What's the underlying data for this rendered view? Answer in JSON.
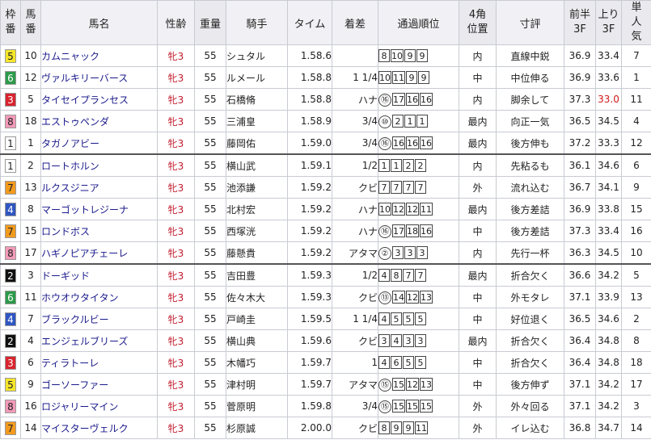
{
  "headers": {
    "waku": "枠番",
    "umaban": "馬番",
    "horse": "馬名",
    "age": "性齢",
    "weight": "重量",
    "jockey": "騎手",
    "time": "タイム",
    "margin": "着差",
    "passing": "通過順位",
    "pos4": "4角位置",
    "comment": "寸評",
    "first3f": "前半3F",
    "last3f": "上り3F",
    "pop": "単人気"
  },
  "waku_colors": {
    "1": {
      "bg": "#ffffff",
      "fg": "#222222"
    },
    "2": {
      "bg": "#111111",
      "fg": "#ffffff"
    },
    "3": {
      "bg": "#d8242e",
      "fg": "#ffffff"
    },
    "4": {
      "bg": "#2f56c2",
      "fg": "#ffffff"
    },
    "5": {
      "bg": "#f5e52a",
      "fg": "#222222"
    },
    "6": {
      "bg": "#2c9a4a",
      "fg": "#ffffff"
    },
    "7": {
      "bg": "#f29a1e",
      "fg": "#222222"
    },
    "8": {
      "bg": "#f39ab8",
      "fg": "#222222"
    }
  },
  "rows": [
    {
      "waku": "5",
      "umaban": "10",
      "horse": "カムニャック",
      "age": "牝3",
      "weight": "55",
      "jockey": "シュタル",
      "time": "1.58.6",
      "margin": "",
      "passing": [
        {
          "v": "8"
        },
        {
          "v": "10"
        },
        {
          "v": "9"
        },
        {
          "v": "9"
        }
      ],
      "pos4": "内",
      "comment": "直線中鋭",
      "first3f": "36.9",
      "last3f": "33.4",
      "last3f_best": false,
      "pop": "7"
    },
    {
      "waku": "6",
      "umaban": "12",
      "horse": "ヴァルキリーバース",
      "age": "牝3",
      "weight": "55",
      "jockey": "ルメール",
      "time": "1.58.8",
      "margin": "1 1/4",
      "passing": [
        {
          "v": "10"
        },
        {
          "v": "11"
        },
        {
          "v": "9"
        },
        {
          "v": "9"
        }
      ],
      "pos4": "中",
      "comment": "中位伸る",
      "first3f": "36.9",
      "last3f": "33.6",
      "last3f_best": false,
      "pop": "1"
    },
    {
      "waku": "3",
      "umaban": "5",
      "horse": "タイセイプランセス",
      "age": "牝3",
      "weight": "55",
      "jockey": "石橋脩",
      "time": "1.58.8",
      "margin": "ハナ",
      "passing": [
        {
          "v": "⑯",
          "c": true
        },
        {
          "v": "17"
        },
        {
          "v": "16"
        },
        {
          "v": "16"
        }
      ],
      "pos4": "内",
      "comment": "脚余して",
      "first3f": "37.3",
      "last3f": "33.0",
      "last3f_best": true,
      "pop": "11"
    },
    {
      "waku": "8",
      "umaban": "18",
      "horse": "エストゥペンダ",
      "age": "牝3",
      "weight": "55",
      "jockey": "三浦皇",
      "time": "1.58.9",
      "margin": "3/4",
      "passing": [
        {
          "v": "⑩",
          "c": true
        },
        {
          "v": "2"
        },
        {
          "v": "1"
        },
        {
          "v": "1"
        }
      ],
      "pos4": "最内",
      "comment": "向正一気",
      "first3f": "36.5",
      "last3f": "34.5",
      "last3f_best": false,
      "pop": "4"
    },
    {
      "waku": "1",
      "umaban": "1",
      "horse": "タガノアビー",
      "age": "牝3",
      "weight": "55",
      "jockey": "藤岡佑",
      "time": "1.59.0",
      "margin": "3/4",
      "passing": [
        {
          "v": "⑯",
          "c": true
        },
        {
          "v": "16"
        },
        {
          "v": "16"
        },
        {
          "v": "16"
        }
      ],
      "pos4": "最内",
      "comment": "後方伸も",
      "first3f": "37.2",
      "last3f": "33.3",
      "last3f_best": false,
      "pop": "12"
    },
    {
      "waku": "1",
      "umaban": "2",
      "horse": "ロートホルン",
      "age": "牝3",
      "weight": "55",
      "jockey": "横山武",
      "time": "1.59.1",
      "margin": "1/2",
      "passing": [
        {
          "v": "1"
        },
        {
          "v": "1"
        },
        {
          "v": "2"
        },
        {
          "v": "2"
        }
      ],
      "pos4": "内",
      "comment": "先粘るも",
      "first3f": "36.1",
      "last3f": "34.6",
      "last3f_best": false,
      "pop": "6"
    },
    {
      "waku": "7",
      "umaban": "13",
      "horse": "ルクスジニア",
      "age": "牝3",
      "weight": "55",
      "jockey": "池添謙",
      "time": "1.59.2",
      "margin": "クビ",
      "passing": [
        {
          "v": "7"
        },
        {
          "v": "7"
        },
        {
          "v": "7"
        },
        {
          "v": "7"
        }
      ],
      "pos4": "外",
      "comment": "流れ込む",
      "first3f": "36.7",
      "last3f": "34.1",
      "last3f_best": false,
      "pop": "9"
    },
    {
      "waku": "4",
      "umaban": "8",
      "horse": "マーゴットレジーナ",
      "age": "牝3",
      "weight": "55",
      "jockey": "北村宏",
      "time": "1.59.2",
      "margin": "ハナ",
      "passing": [
        {
          "v": "10"
        },
        {
          "v": "12"
        },
        {
          "v": "12"
        },
        {
          "v": "11"
        }
      ],
      "pos4": "最内",
      "comment": "後方差詰",
      "first3f": "36.9",
      "last3f": "33.8",
      "last3f_best": false,
      "pop": "15"
    },
    {
      "waku": "7",
      "umaban": "15",
      "horse": "ロンドボス",
      "age": "牝3",
      "weight": "55",
      "jockey": "西塚洸",
      "time": "1.59.2",
      "margin": "ハナ",
      "passing": [
        {
          "v": "⑯",
          "c": true
        },
        {
          "v": "17"
        },
        {
          "v": "18"
        },
        {
          "v": "16"
        }
      ],
      "pos4": "中",
      "comment": "後方差詰",
      "first3f": "37.3",
      "last3f": "33.4",
      "last3f_best": false,
      "pop": "16"
    },
    {
      "waku": "8",
      "umaban": "17",
      "horse": "ハギノピアチェーレ",
      "age": "牝3",
      "weight": "55",
      "jockey": "藤懸貴",
      "time": "1.59.2",
      "margin": "アタマ",
      "passing": [
        {
          "v": "②",
          "c": true
        },
        {
          "v": "3"
        },
        {
          "v": "3"
        },
        {
          "v": "3"
        }
      ],
      "pos4": "内",
      "comment": "先行一杯",
      "first3f": "36.3",
      "last3f": "34.5",
      "last3f_best": false,
      "pop": "10"
    },
    {
      "waku": "2",
      "umaban": "3",
      "horse": "ドーギッド",
      "age": "牝3",
      "weight": "55",
      "jockey": "吉田豊",
      "time": "1.59.3",
      "margin": "1/2",
      "passing": [
        {
          "v": "4"
        },
        {
          "v": "8"
        },
        {
          "v": "7"
        },
        {
          "v": "7"
        }
      ],
      "pos4": "最内",
      "comment": "折合欠く",
      "first3f": "36.6",
      "last3f": "34.2",
      "last3f_best": false,
      "pop": "5"
    },
    {
      "waku": "6",
      "umaban": "11",
      "horse": "ホウオウタイタン",
      "age": "牝3",
      "weight": "55",
      "jockey": "佐々木大",
      "time": "1.59.3",
      "margin": "クビ",
      "passing": [
        {
          "v": "⑬",
          "c": true
        },
        {
          "v": "14"
        },
        {
          "v": "12"
        },
        {
          "v": "13"
        }
      ],
      "pos4": "中",
      "comment": "外モタレ",
      "first3f": "37.1",
      "last3f": "33.9",
      "last3f_best": false,
      "pop": "13"
    },
    {
      "waku": "4",
      "umaban": "7",
      "horse": "ブラックルビー",
      "age": "牝3",
      "weight": "55",
      "jockey": "戸崎圭",
      "time": "1.59.5",
      "margin": "1 1/4",
      "passing": [
        {
          "v": "4"
        },
        {
          "v": "5"
        },
        {
          "v": "5"
        },
        {
          "v": "5"
        }
      ],
      "pos4": "中",
      "comment": "好位退く",
      "first3f": "36.5",
      "last3f": "34.6",
      "last3f_best": false,
      "pop": "2"
    },
    {
      "waku": "2",
      "umaban": "4",
      "horse": "エンジェルブリーズ",
      "age": "牝3",
      "weight": "55",
      "jockey": "横山典",
      "time": "1.59.6",
      "margin": "クビ",
      "passing": [
        {
          "v": "3"
        },
        {
          "v": "4"
        },
        {
          "v": "3"
        },
        {
          "v": "3"
        }
      ],
      "pos4": "最内",
      "comment": "折合欠く",
      "first3f": "36.4",
      "last3f": "34.8",
      "last3f_best": false,
      "pop": "8"
    },
    {
      "waku": "3",
      "umaban": "6",
      "horse": "ティラトーレ",
      "age": "牝3",
      "weight": "55",
      "jockey": "木幡巧",
      "time": "1.59.7",
      "margin": "1",
      "passing": [
        {
          "v": "4"
        },
        {
          "v": "6"
        },
        {
          "v": "5"
        },
        {
          "v": "5"
        }
      ],
      "pos4": "中",
      "comment": "折合欠く",
      "first3f": "36.4",
      "last3f": "34.8",
      "last3f_best": false,
      "pop": "18"
    },
    {
      "waku": "5",
      "umaban": "9",
      "horse": "ゴーソーファー",
      "age": "牝3",
      "weight": "55",
      "jockey": "津村明",
      "time": "1.59.7",
      "margin": "アタマ",
      "passing": [
        {
          "v": "⑮",
          "c": true
        },
        {
          "v": "15"
        },
        {
          "v": "12"
        },
        {
          "v": "13"
        }
      ],
      "pos4": "中",
      "comment": "後方伸ず",
      "first3f": "37.1",
      "last3f": "34.2",
      "last3f_best": false,
      "pop": "17"
    },
    {
      "waku": "8",
      "umaban": "16",
      "horse": "ロジャリーマイン",
      "age": "牝3",
      "weight": "55",
      "jockey": "菅原明",
      "time": "1.59.8",
      "margin": "3/4",
      "passing": [
        {
          "v": "⑮",
          "c": true
        },
        {
          "v": "15"
        },
        {
          "v": "15"
        },
        {
          "v": "15"
        }
      ],
      "pos4": "外",
      "comment": "外々回る",
      "first3f": "37.1",
      "last3f": "34.2",
      "last3f_best": false,
      "pop": "3"
    },
    {
      "waku": "7",
      "umaban": "14",
      "horse": "マイスターヴェルク",
      "age": "牝3",
      "weight": "55",
      "jockey": "杉原誠",
      "time": "2.00.0",
      "margin": "クビ",
      "passing": [
        {
          "v": "8"
        },
        {
          "v": "9"
        },
        {
          "v": "9"
        },
        {
          "v": "11"
        }
      ],
      "pos4": "外",
      "comment": "イレ込む",
      "first3f": "36.8",
      "last3f": "34.7",
      "last3f_best": false,
      "pop": "14"
    }
  ]
}
